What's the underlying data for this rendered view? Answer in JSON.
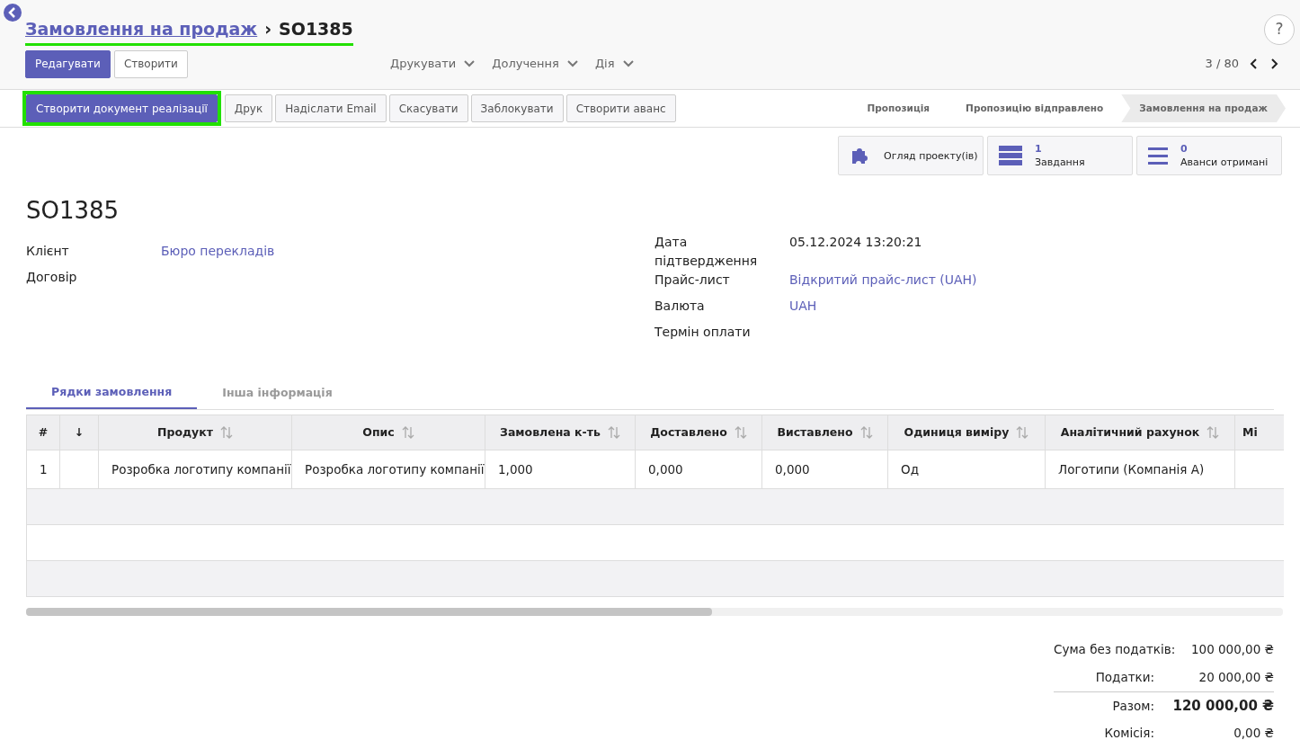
{
  "breadcrumb": {
    "parent": "Замовлення на продаж",
    "separator": "›",
    "current": "SO1385",
    "highlighted": true
  },
  "help": "?",
  "main_buttons": [
    {
      "label": "Редагувати",
      "primary": true
    },
    {
      "label": "Створити",
      "primary": false
    }
  ],
  "dropdowns": [
    "Друкувати",
    "Долучення",
    "Дія"
  ],
  "pager": {
    "text": "3 / 80"
  },
  "action_buttons": [
    {
      "label": "Створити документ реалізації",
      "primary": true,
      "highlighted": true
    },
    {
      "label": "Друк",
      "primary": false,
      "highlighted": false
    },
    {
      "label": "Надіслати Email",
      "primary": false,
      "highlighted": false
    },
    {
      "label": "Скасувати",
      "primary": false,
      "highlighted": false
    },
    {
      "label": "Заблокувати",
      "primary": false,
      "highlighted": false
    },
    {
      "label": "Створити аванс",
      "primary": false,
      "highlighted": false
    }
  ],
  "stages": [
    {
      "label": "Пропозиція",
      "selected": false
    },
    {
      "label": "Пропозицію відправлено",
      "selected": false
    },
    {
      "label": "Замовлення на продаж",
      "selected": true
    }
  ],
  "smart_buttons": [
    {
      "kind": "puzzle",
      "label": "Огляд проекту(ів)"
    },
    {
      "kind": "tasks",
      "count": "1",
      "label": "Завдання"
    },
    {
      "kind": "list",
      "count": "0",
      "label": "Аванси отримані"
    }
  ],
  "title": "SO1385",
  "left_fields": [
    {
      "label": "Клієнт",
      "value": "Бюро перекладів",
      "link": true
    },
    {
      "label": "Договір"
    }
  ],
  "right_fields": [
    {
      "label": "Дата підтвердження",
      "value": "05.12.2024 13:20:21",
      "link": false
    },
    {
      "label": "Прайс-лист",
      "value": "Відкритий прайс-лист (UAH)",
      "link": true
    },
    {
      "label": "Валюта",
      "value": "UAH",
      "link": true
    },
    {
      "label": "Термін оплати"
    }
  ],
  "tabs": [
    {
      "label": "Рядки замовлення",
      "selected": true
    },
    {
      "label": "Інша інформація",
      "selected": false
    }
  ],
  "table": {
    "columns": [
      {
        "label": "#",
        "sortable": false
      },
      {
        "label": "↓",
        "sortable": false
      },
      {
        "label": "Продукт",
        "sortable": true
      },
      {
        "label": "Опис",
        "sortable": true
      },
      {
        "label": "Замовлена к-ть",
        "sortable": true
      },
      {
        "label": "Доставлено",
        "sortable": true
      },
      {
        "label": "Виставлено",
        "sortable": true
      },
      {
        "label": "Одиниця виміру",
        "sortable": true
      },
      {
        "label": "Аналітичний рахунок",
        "sortable": true
      },
      {
        "label": "Мі",
        "sortable": false
      }
    ],
    "rows": [
      [
        "1",
        "",
        "Розробка логотипу компанії",
        "Розробка логотипу компанії",
        "1,000",
        "0,000",
        "0,000",
        "Од",
        "Логотипи (Компанія А)",
        ""
      ]
    ]
  },
  "totals": [
    {
      "label": "Сума без податків:",
      "value": "100 000,00 ₴",
      "bold": false
    },
    {
      "label": "Податки:",
      "value": "20 000,00 ₴",
      "bold": false
    },
    {
      "label": "Разом:",
      "value": "120 000,00 ₴",
      "bold": true
    },
    {
      "label": "Комісія:",
      "value": "0,00 ₴",
      "bold": false
    }
  ]
}
